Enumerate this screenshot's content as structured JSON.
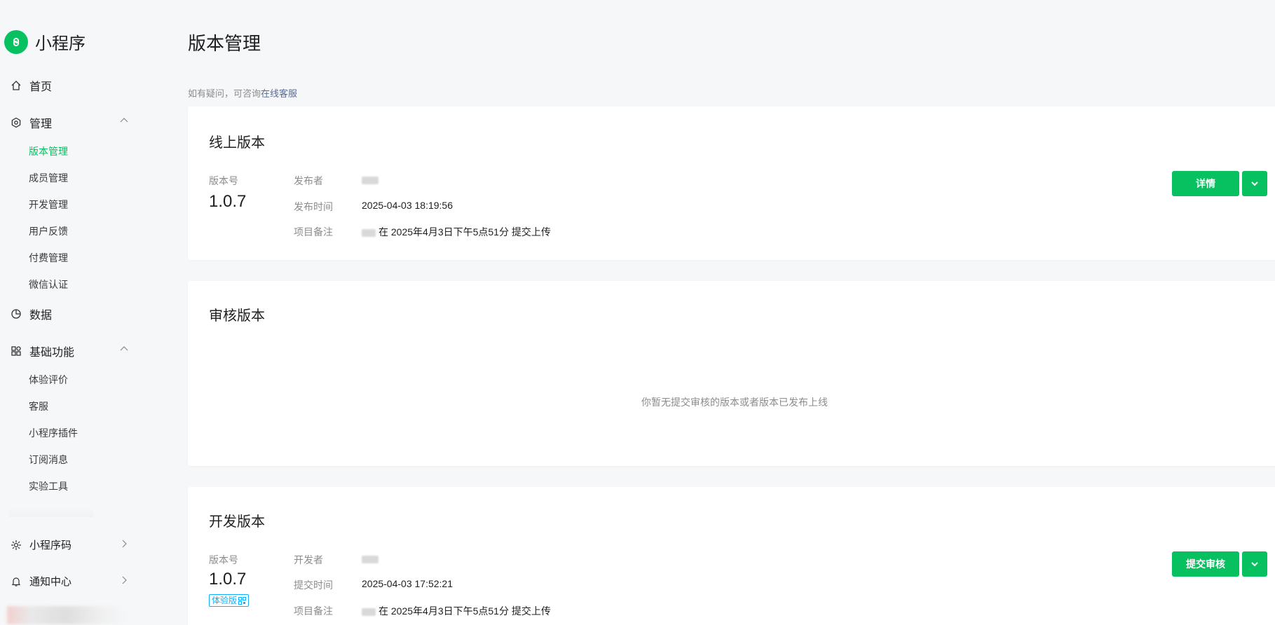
{
  "app": {
    "name": "小程序"
  },
  "sidebar": {
    "home": "首页",
    "manage": {
      "label": "管理",
      "items": [
        "版本管理",
        "成员管理",
        "开发管理",
        "用户反馈",
        "付费管理",
        "微信认证"
      ]
    },
    "data": "数据",
    "basic": {
      "label": "基础功能",
      "items": [
        "体验评价",
        "客服",
        "小程序插件",
        "订阅消息",
        "实验工具"
      ]
    },
    "qrcode": "小程序码",
    "notify": "通知中心"
  },
  "page": {
    "title": "版本管理",
    "help_prefix": "如有疑问，可咨询",
    "help_link": "在线客服"
  },
  "online": {
    "title": "线上版本",
    "version_label": "版本号",
    "version": "1.0.7",
    "publisher_label": "发布者",
    "time_label": "发布时间",
    "time": "2025-04-03 18:19:56",
    "note_label": "项目备注",
    "note": "在 2025年4月3日下午5点51分 提交上传",
    "detail_button": "详情"
  },
  "review": {
    "title": "审核版本",
    "empty": "你暂无提交审核的版本或者版本已发布上线"
  },
  "dev": {
    "title": "开发版本",
    "version_label": "版本号",
    "version": "1.0.7",
    "badge": "体验版",
    "developer_label": "开发者",
    "time_label": "提交时间",
    "time": "2025-04-03 17:52:21",
    "note_label": "项目备注",
    "note": "在 2025年4月3日下午5点51分 提交上传",
    "submit_button": "提交审核"
  },
  "colors": {
    "accent": "#07c160",
    "link": "#576b95",
    "badge": "#10aeff"
  }
}
